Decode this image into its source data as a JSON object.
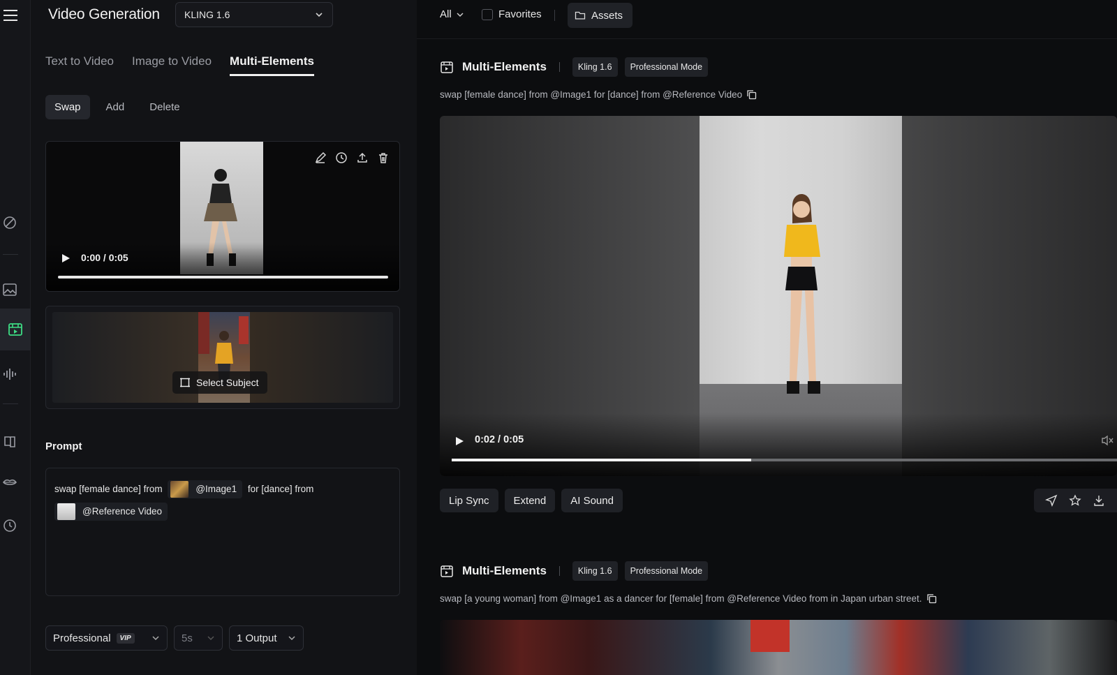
{
  "header": {
    "title": "Video Generation",
    "model": "KLING 1.6"
  },
  "tabs": [
    "Text to Video",
    "Image to Video",
    "Multi-Elements"
  ],
  "subtabs": [
    "Swap",
    "Add",
    "Delete"
  ],
  "upload_video": {
    "time": "0:00 / 0:05"
  },
  "subject": {
    "button": "Select Subject"
  },
  "prompt": {
    "label": "Prompt",
    "part1": "swap [female dance] from",
    "chip1": "@Image1",
    "part2": "for [dance] from",
    "chip2": "@Reference Video"
  },
  "settings": {
    "mode": "Professional",
    "vip": "VIP",
    "duration": "5s",
    "outputs": "1 Output"
  },
  "topbar": {
    "filter": "All",
    "favorites": "Favorites",
    "assets": "Assets"
  },
  "results": [
    {
      "title": "Multi-Elements",
      "tags": [
        "Kling 1.6",
        "Professional Mode"
      ],
      "prompt": "swap [female dance] from @Image1 for [dance] from @Reference Video",
      "time": "0:02 / 0:05",
      "progress": 0.45,
      "actions": [
        "Lip Sync",
        "Extend",
        "AI Sound"
      ]
    },
    {
      "title": "Multi-Elements",
      "tags": [
        "Kling 1.6",
        "Professional Mode"
      ],
      "prompt": "swap [a young woman] from @Image1 as a dancer for [female] from @Reference Video from in Japan urban street."
    }
  ],
  "colors": {
    "accent": "#3ddc84",
    "panel": "#121316",
    "background": "#0c0d0f"
  }
}
